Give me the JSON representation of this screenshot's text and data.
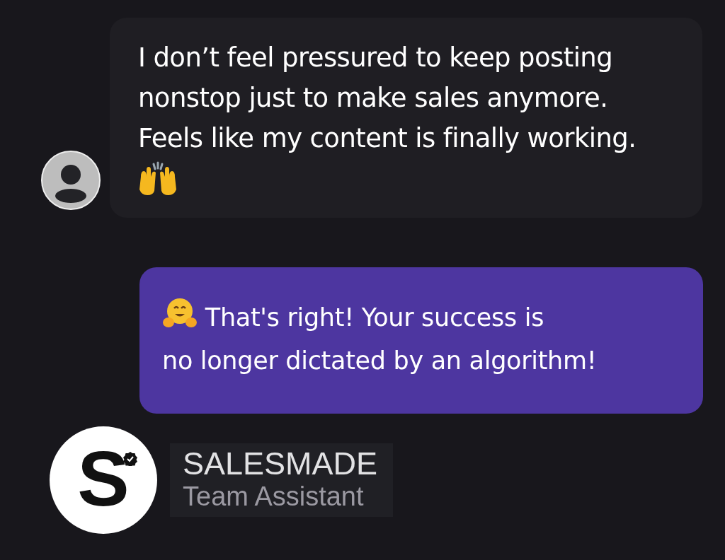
{
  "messages": [
    {
      "kind": "incoming",
      "text": "I don’t feel pressured to keep posting\nnonstop just to make sales anymore.\nFeels like my content is finally working."
    },
    {
      "kind": "outgoing",
      "text": "That's right! Your success is\nno longer dictated by an algorithm!"
    }
  ],
  "sender": {
    "logo": "S",
    "verified": true,
    "name": "SALESMADE",
    "role": "Team Assistant"
  }
}
